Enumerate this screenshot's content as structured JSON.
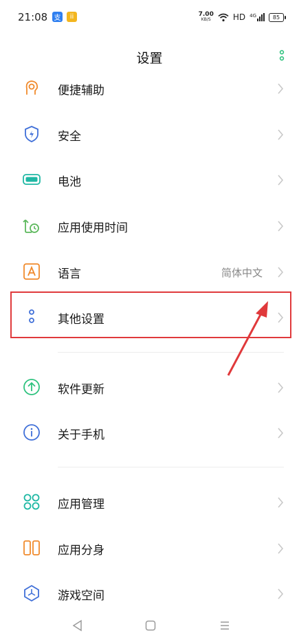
{
  "status_bar": {
    "time": "21:08",
    "notif_a": "支",
    "notif_b": "ii",
    "net_speed_value": "7.00",
    "net_speed_unit": "KB/S",
    "hd": "HD",
    "signal": "4G",
    "battery": "85"
  },
  "header": {
    "title": "设置"
  },
  "items": [
    {
      "label": "便捷辅助",
      "icon": "accessibility-icon"
    },
    {
      "label": "安全",
      "icon": "shield-icon"
    },
    {
      "label": "电池",
      "icon": "battery-icon"
    },
    {
      "label": "应用使用时间",
      "icon": "app-timer-icon"
    },
    {
      "label": "语言",
      "value": "简体中文",
      "icon": "language-icon"
    },
    {
      "label": "其他设置",
      "icon": "other-settings-icon"
    },
    {
      "label": "软件更新",
      "icon": "update-icon"
    },
    {
      "label": "关于手机",
      "icon": "info-icon"
    },
    {
      "label": "应用管理",
      "icon": "app-manager-icon"
    },
    {
      "label": "应用分身",
      "icon": "app-clone-icon"
    },
    {
      "label": "游戏空间",
      "icon": "game-space-icon"
    }
  ],
  "colors": {
    "accent_green": "#2ec27e",
    "highlight_red": "#e0393b",
    "chevron": "#c8c8c8"
  }
}
